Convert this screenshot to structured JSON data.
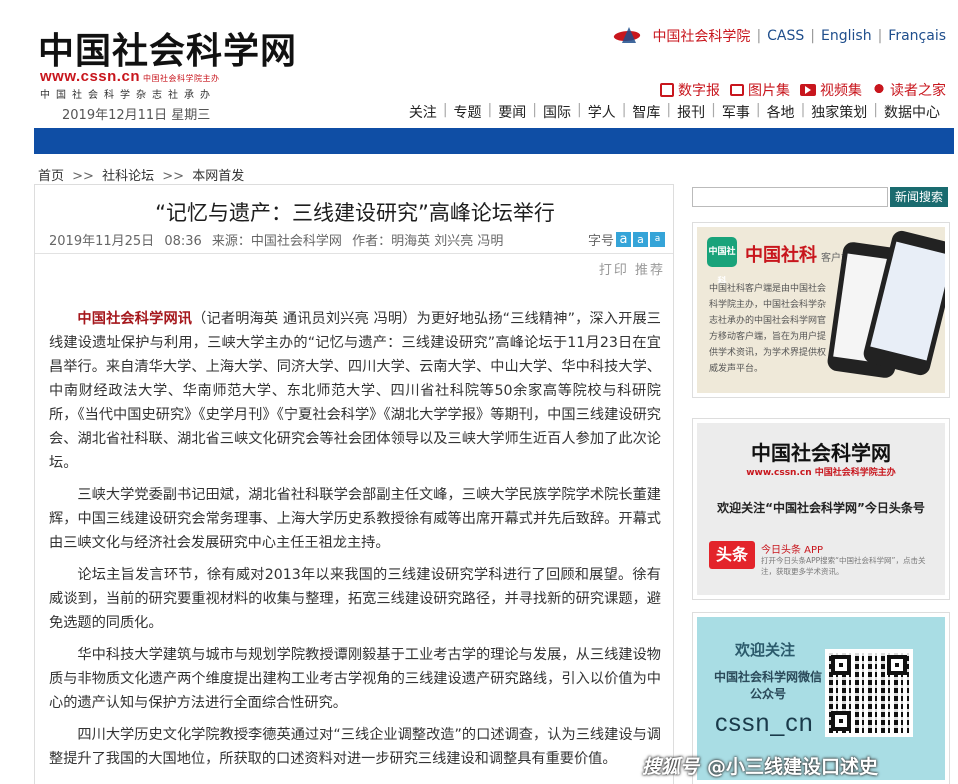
{
  "header": {
    "logo_cn": "中国社会科学网",
    "logo_url": "www.cssn.cn",
    "logo_url_tag": "中国社会科学院主办",
    "logo_sub": "中国社会科学杂志社承办",
    "date": "2019年12月11日 星期三",
    "top_links": [
      "中国社会科学院",
      "CASS",
      "English",
      "Français"
    ],
    "icon_links": [
      {
        "icon": "newspaper-icon",
        "label": "数字报"
      },
      {
        "icon": "image-icon",
        "label": "图片集"
      },
      {
        "icon": "video-icon",
        "label": "视频集"
      },
      {
        "icon": "reader-icon",
        "label": "读者之家"
      }
    ],
    "nav": [
      "关注",
      "专题",
      "要闻",
      "国际",
      "学人",
      "智库",
      "报刊",
      "军事",
      "各地",
      "独家策划",
      "数据中心"
    ]
  },
  "breadcrumb": {
    "items": [
      "首页",
      "社科论坛",
      "本网首发"
    ],
    "separator": ">>"
  },
  "article": {
    "title": "“记忆与遗产：三线建设研究”高峰论坛举行",
    "date": "2019年11月25日",
    "time": "08:36",
    "source": "来源：中国社会科学网",
    "author": "作者：明海英 刘兴亮 冯明",
    "font_label": "字号",
    "font_buttons": [
      "a",
      "a",
      "a"
    ],
    "print": "打印",
    "recommend": "推荐",
    "lead_source": "中国社会科学网讯",
    "paragraphs": [
      "（记者明海英 通讯员刘兴亮 冯明）为更好地弘扬“三线精神”，深入开展三线建设遗址保护与利用，三峡大学主办的“记忆与遗产：三线建设研究”高峰论坛于11月23日在宜昌举行。来自清华大学、上海大学、同济大学、四川大学、云南大学、中山大学、华中科技大学、中南财经政法大学、华南师范大学、东北师范大学、四川省社科院等50余家高等院校与科研院所，《当代中国史研究》《史学月刊》《宁夏社会科学》《湖北大学学报》等期刊，中国三线建设研究会、湖北省社科联、湖北省三峡文化研究会等社会团体领导以及三峡大学师生近百人参加了此次论坛。",
      "三峡大学党委副书记田斌，湖北省社科联学会部副主任文峰，三峡大学民族学院学术院长董建辉，中国三线建设研究会常务理事、上海大学历史系教授徐有威等出席开幕式并先后致辞。开幕式由三峡文化与经济社会发展研究中心主任王祖龙主持。",
      "论坛主旨发言环节，徐有威对2013年以来我国的三线建设研究学科进行了回顾和展望。徐有威谈到，当前的研究要重视材料的收集与整理，拓宽三线建设研究路径，并寻找新的研究课题，避免选题的同质化。",
      "华中科技大学建筑与城市与规划学院教授谭刚毅基于工业考古学的理论与发展，从三线建设物质与非物质文化遗产两个维度提出建构工业考古学视角的三线建设遗产研究路线，引入以价值为中心的遗产认知与保护方法进行全面综合性研究。",
      "四川大学历史文化学院教授李德英通过对“三线企业调整改造”的口述调查，认为三线建设与调整提升了我国的大国地位，所获取的口述资料对进一步研究三线建设和调整具有重要价值。"
    ]
  },
  "sidebar": {
    "search_button": "新闻搜索",
    "ad1": {
      "badge": "中国社科",
      "title": "中国社科",
      "subtitle": "客户端",
      "desc": "中国社科客户端是由中国社会科学院主办，中国社会科学杂志社承办的中国社会科学网官方移动客户端，旨在为用户提供学术资讯，为学术界提供权威发声平台。"
    },
    "ad2": {
      "logo": "中国社会科学网",
      "url": "www.cssn.cn 中国社会科学院主办",
      "follow": "欢迎关注“中国社会科学网”今日头条号",
      "toutiao": "头条",
      "app_label": "今日头条 APP",
      "app_desc": "打开今日头条APP搜索“中国社会科学网”，点击关注，获取更多学术资讯。"
    },
    "ad3": {
      "welcome": "欢迎关注",
      "wechat": "中国社会科学网微信公众号",
      "handle": "cssn_cn"
    }
  },
  "watermark": {
    "brand": "搜狐号",
    "text": "@小三线建设口述史"
  }
}
